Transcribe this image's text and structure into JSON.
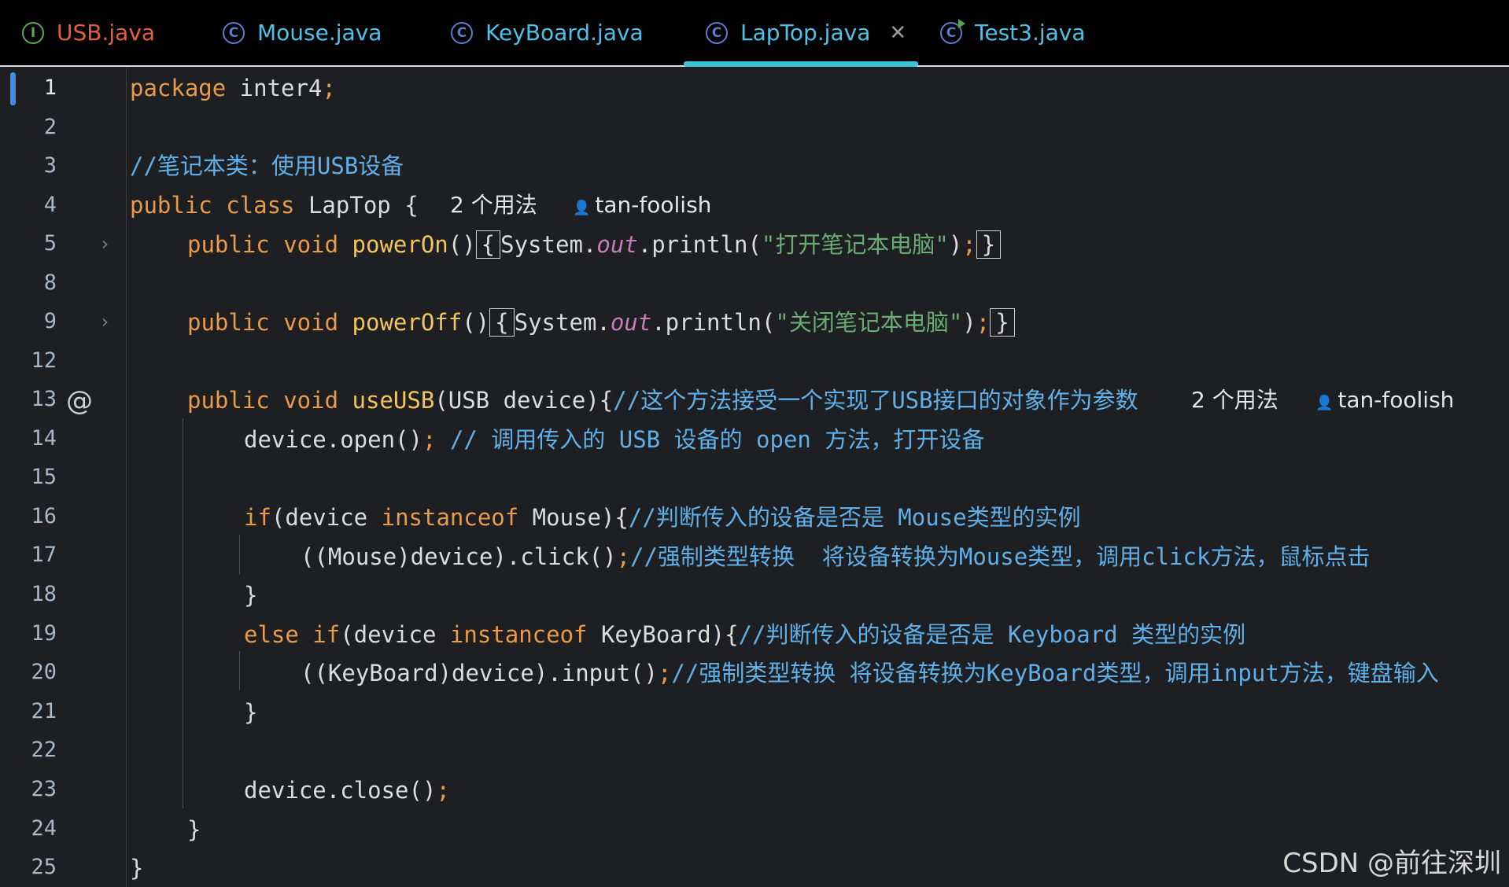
{
  "tabs": [
    {
      "label": "USB.java",
      "icon": "interface-icon",
      "active": false,
      "color": "#e0603f"
    },
    {
      "label": "Mouse.java",
      "icon": "class-icon",
      "active": false,
      "color": "#4fc1e9"
    },
    {
      "label": "KeyBoard.java",
      "icon": "class-icon",
      "active": false,
      "color": "#4fc1e9"
    },
    {
      "label": "LapTop.java",
      "icon": "class-icon",
      "active": true,
      "color": "#4fc1e9"
    },
    {
      "label": "Test3.java",
      "icon": "runnable-class-icon",
      "active": false,
      "color": "#4fc1e9"
    }
  ],
  "gutter": {
    "line_numbers": [
      "1",
      "2",
      "3",
      "4",
      "5",
      "8",
      "9",
      "12",
      "13",
      "14",
      "15",
      "16",
      "17",
      "18",
      "19",
      "20",
      "21",
      "22",
      "23",
      "24",
      "25"
    ]
  },
  "code": {
    "l1": {
      "kw": "package",
      "rest": " inter4",
      "semi": ";"
    },
    "l3": {
      "comment": "//笔记本类：使用USB设备"
    },
    "l4": {
      "kw": "public class",
      "rest": " LapTop {"
    },
    "l5": {
      "kw": "public void",
      "fn": "powerOn",
      "paren": "()",
      "open": "{",
      "sys": "System.",
      "out": "out",
      "call": ".println(",
      "str": "\"打开笔记本电脑\"",
      "close_paren": ")",
      "semi": ";",
      "close": "}"
    },
    "l9": {
      "kw": "public void",
      "fn": "powerOff",
      "paren": "()",
      "open": "{",
      "sys": "System.",
      "out": "out",
      "call": ".println(",
      "str": "\"关闭笔记本电脑\"",
      "close_paren": ")",
      "semi": ";",
      "close": "}"
    },
    "l13": {
      "kw": "public void",
      "fn": "useUSB",
      "args": "(USB device){",
      "comment": "//这个方法接受一个实现了USB接口的对象作为参数"
    },
    "l14": {
      "code": "device.open()",
      "semi": ";",
      "comment": " // 调用传入的 USB 设备的 open 方法，打开设备"
    },
    "l16": {
      "kw": "if",
      "a": "(device ",
      "kw2": "instanceof",
      "b": " Mouse){",
      "comment": "//判断传入的设备是否是 Mouse类型的实例"
    },
    "l17": {
      "code": "((Mouse)device).click()",
      "semi": ";",
      "comment": "//强制类型转换  将设备转换为Mouse类型，调用click方法，鼠标点击"
    },
    "l18": {
      "code": "}"
    },
    "l19": {
      "kw": "else if",
      "a": "(device ",
      "kw2": "instanceof",
      "b": " KeyBoard){",
      "comment": "//判断传入的设备是否是 Keyboard 类型的实例"
    },
    "l20": {
      "code": "((KeyBoard)device).input()",
      "semi": ";",
      "comment": "//强制类型转换 将设备转换为KeyBoard类型，调用input方法，键盘输入"
    },
    "l21": {
      "code": "}"
    },
    "l23": {
      "code": "device.close()",
      "semi": ";"
    },
    "l24": {
      "code": "}"
    },
    "l25": {
      "code": "}"
    }
  },
  "hints": {
    "usages_class": "2 个用法",
    "author_class": "tan-foolish",
    "usages_method": "2 个用法",
    "author_method": "tan-foolish"
  },
  "watermark": "CSDN @前往深圳"
}
